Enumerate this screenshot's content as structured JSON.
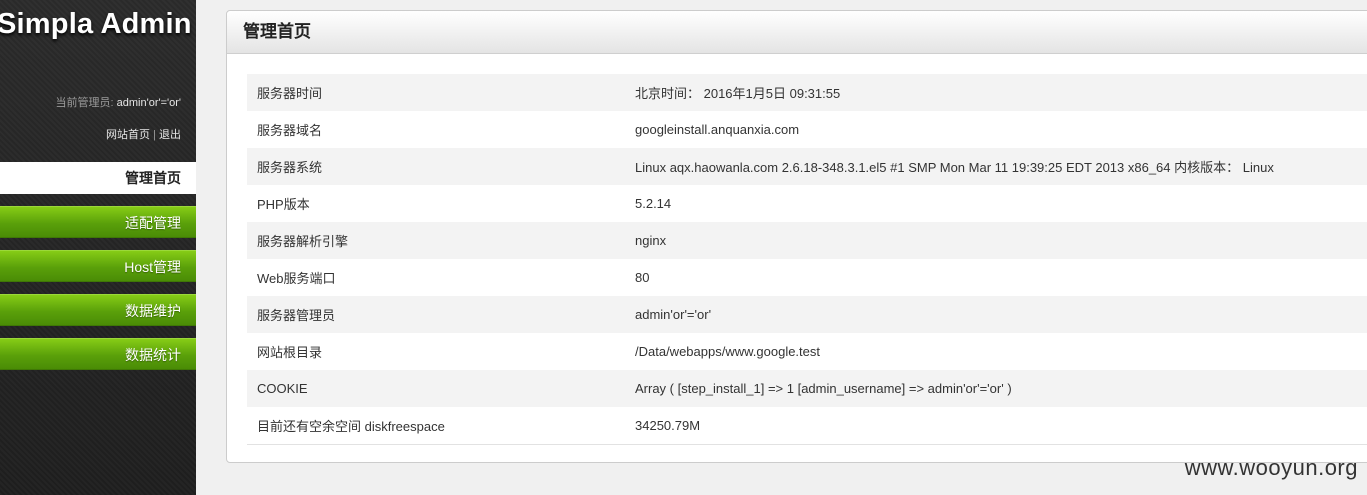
{
  "sidebar": {
    "brand": "Simpla Admin",
    "admin_prefix": "当前管理员:",
    "admin_name": "admin'or'='or'",
    "link_home": "网站首页",
    "link_sep": "|",
    "link_logout": "退出",
    "nav": [
      {
        "label": "管理首页"
      },
      {
        "label": "适配管理"
      },
      {
        "label": "Host管理"
      },
      {
        "label": "数据维护"
      },
      {
        "label": "数据统计"
      }
    ]
  },
  "main": {
    "title": "管理首页",
    "rows": [
      {
        "key": "服务器时间",
        "value": "北京时间： 2016年1月5日 09:31:55"
      },
      {
        "key": "服务器域名",
        "value": "googleinstall.anquanxia.com"
      },
      {
        "key": "服务器系统",
        "value": "Linux aqx.haowanla.com 2.6.18-348.3.1.el5 #1 SMP Mon Mar 11 19:39:25 EDT 2013 x86_64  内核版本： Linux"
      },
      {
        "key": "PHP版本",
        "value": "5.2.14"
      },
      {
        "key": "服务器解析引擎",
        "value": "nginx"
      },
      {
        "key": "Web服务端口",
        "value": "80"
      },
      {
        "key": "服务器管理员",
        "value": "admin'or'='or'"
      },
      {
        "key": "网站根目录",
        "value": "/Data/webapps/www.google.test"
      },
      {
        "key": "COOKIE",
        "value": "Array ( [step_install_1] => 1 [admin_username] => admin'or'='or' )"
      },
      {
        "key": "目前还有空余空间 diskfreespace",
        "value": "34250.79M"
      }
    ]
  },
  "watermark": "www.wooyun.org",
  "colors": {
    "nav_green": "#5aa00a",
    "sidebar_bg": "#262626"
  }
}
